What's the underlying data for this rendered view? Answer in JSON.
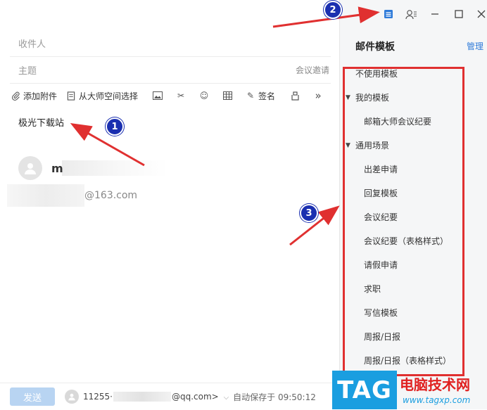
{
  "compose": {
    "recipient_placeholder": "收件人",
    "subject_placeholder": "主题",
    "meeting_link": "会议邀请",
    "body_text": "极光下载站"
  },
  "toolbar": {
    "attach": "添加附件",
    "from_space": "从大师空间选择",
    "sign": "签名",
    "more": "»"
  },
  "signature": {
    "name_initial": "m",
    "email_suffix": "@163.com"
  },
  "bottom": {
    "send": "发送",
    "account_prefix": "11255·",
    "account_suffix": "@qq.com>",
    "autosave": "自动保存于 09:50:12"
  },
  "template_panel": {
    "title": "邮件模板",
    "manage": "管理",
    "items": [
      {
        "label": "不使用模板",
        "level": 0,
        "caret": false
      },
      {
        "label": "我的模板",
        "level": 0,
        "caret": true
      },
      {
        "label": "邮箱大师会议纪要",
        "level": 1,
        "caret": false
      },
      {
        "label": "通用场景",
        "level": 0,
        "caret": true
      },
      {
        "label": "出差申请",
        "level": 1,
        "caret": false
      },
      {
        "label": "回复模板",
        "level": 1,
        "caret": false
      },
      {
        "label": "会议纪要",
        "level": 1,
        "caret": false
      },
      {
        "label": "会议纪要（表格样式）",
        "level": 1,
        "caret": false
      },
      {
        "label": "请假申请",
        "level": 1,
        "caret": false
      },
      {
        "label": "求职",
        "level": 1,
        "caret": false
      },
      {
        "label": "写信模板",
        "level": 1,
        "caret": false
      },
      {
        "label": "周报/日报",
        "level": 1,
        "caret": false
      },
      {
        "label": "周报/日报（表格样式）",
        "level": 1,
        "caret": false
      }
    ]
  },
  "annotations": {
    "badge1": "1",
    "badge2": "2",
    "badge3": "3",
    "highlight_color": "#e03030",
    "badge_color": "#1a2fb0"
  },
  "watermark": {
    "logo": "TAG",
    "site_name": "电脑技术网",
    "url": "www.tagxp.com"
  }
}
